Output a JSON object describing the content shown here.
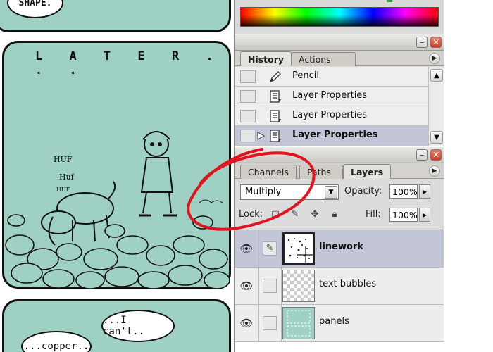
{
  "comic": {
    "caption": "L A T E R . . .",
    "speech_shape": "SHAPE.",
    "sfx_huf1": "HUF",
    "sfx_huf2": "Huf",
    "sfx_huf3": "HUF",
    "speech_copper": "...copper..",
    "speech_icant": "...I can't.."
  },
  "history": {
    "tabs": [
      "History",
      "Actions"
    ],
    "rows": [
      {
        "label": "Pencil",
        "icon": "pencil-icon"
      },
      {
        "label": "Layer Properties",
        "icon": "layer-properties-icon"
      },
      {
        "label": "Layer Properties",
        "icon": "layer-properties-icon"
      },
      {
        "label": "Layer Properties",
        "icon": "layer-properties-icon",
        "current": true
      }
    ]
  },
  "layers": {
    "tabs": [
      "Channels",
      "Paths",
      "Layers"
    ],
    "blend_mode": "Multiply",
    "opacity_label": "Opacity:",
    "opacity_value": "100%",
    "lock_label": "Lock:",
    "fill_label": "Fill:",
    "fill_value": "100%",
    "rows": [
      {
        "name": "linework",
        "selected": true,
        "visible": true
      },
      {
        "name": "text bubbles",
        "selected": false,
        "visible": true
      },
      {
        "name": "panels",
        "selected": false,
        "visible": true
      }
    ]
  },
  "colors": {
    "panel_teal": "#9ed1c3",
    "selected_row": "#c3c6d6",
    "close_red": "#d23a28",
    "annotation_red": "#e0141e"
  }
}
